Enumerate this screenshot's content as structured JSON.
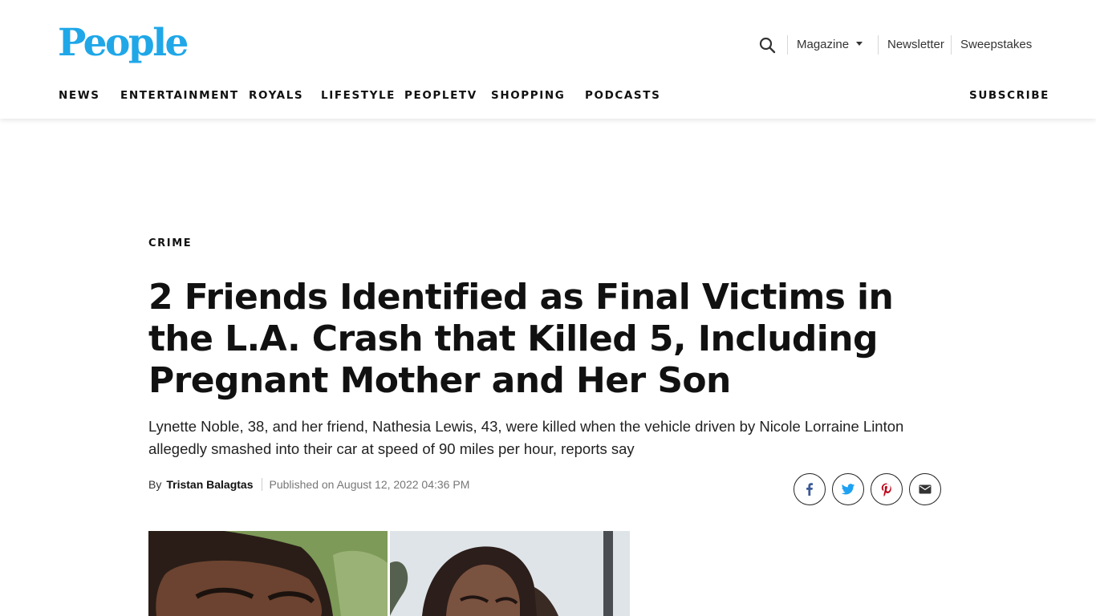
{
  "brand": {
    "logo": "People",
    "logo_color": "#1fa7e8"
  },
  "utility_nav": {
    "magazine": "Magazine",
    "newsletter": "Newsletter",
    "sweepstakes": "Sweepstakes"
  },
  "main_nav": {
    "items": [
      "NEWS",
      "ENTERTAINMENT",
      "ROYALS",
      "LIFESTYLE",
      "PEOPLETV",
      "SHOPPING",
      "PODCASTS"
    ],
    "subscribe": "SUBSCRIBE"
  },
  "article": {
    "category": "CRIME",
    "headline": "2 Friends Identified as Final Victims in the L.A. Crash that Killed 5, Including Pregnant Mother and Her Son",
    "dek": "Lynette Noble, 38, and her friend, Nathesia Lewis, 43, were killed when the vehicle driven by Nicole Lorraine Linton allegedly smashed into their car at speed of 90 miles per hour, reports say",
    "byline_prefix": "By",
    "author": "Tristan Balagtas",
    "published": "Published on August 12, 2022 04:36 PM"
  },
  "share": {
    "icons": [
      "facebook-icon",
      "twitter-icon",
      "pinterest-icon",
      "email-icon"
    ],
    "colors": {
      "facebook": "#3b5998",
      "twitter": "#1da1f2",
      "pinterest": "#bd081c",
      "email": "#333333"
    }
  }
}
